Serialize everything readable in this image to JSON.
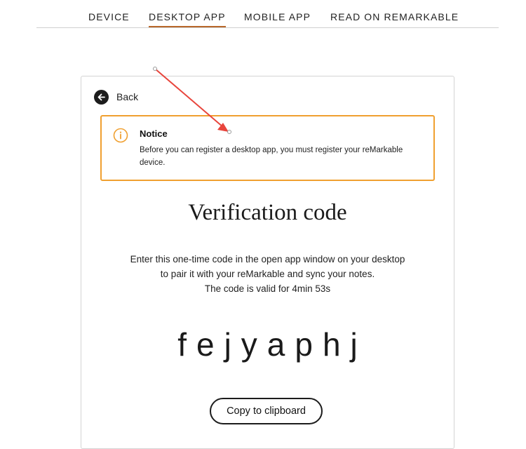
{
  "tabs": [
    {
      "label": "DEVICE",
      "active": false
    },
    {
      "label": "DESKTOP APP",
      "active": true
    },
    {
      "label": "MOBILE APP",
      "active": false
    },
    {
      "label": "READ ON REMARKABLE",
      "active": false
    }
  ],
  "back": {
    "label": "Back",
    "icon": "arrow-left-icon"
  },
  "notice": {
    "icon": "info-icon",
    "title": "Notice",
    "body": "Before you can register a desktop app, you must register your reMarkable device."
  },
  "verification": {
    "title": "Verification code",
    "instruction_line1": "Enter this one-time code in the open app window on your desktop",
    "instruction_line2": "to pair it with your reMarkable and sync your notes.",
    "validity": "The code is valid for 4min 53s",
    "code": "fejyaphj",
    "copy_button": "Copy to clipboard"
  },
  "colors": {
    "accent_underline": "#b8672a",
    "notice_border": "#f0a030",
    "annotation_arrow": "#e8453c"
  }
}
